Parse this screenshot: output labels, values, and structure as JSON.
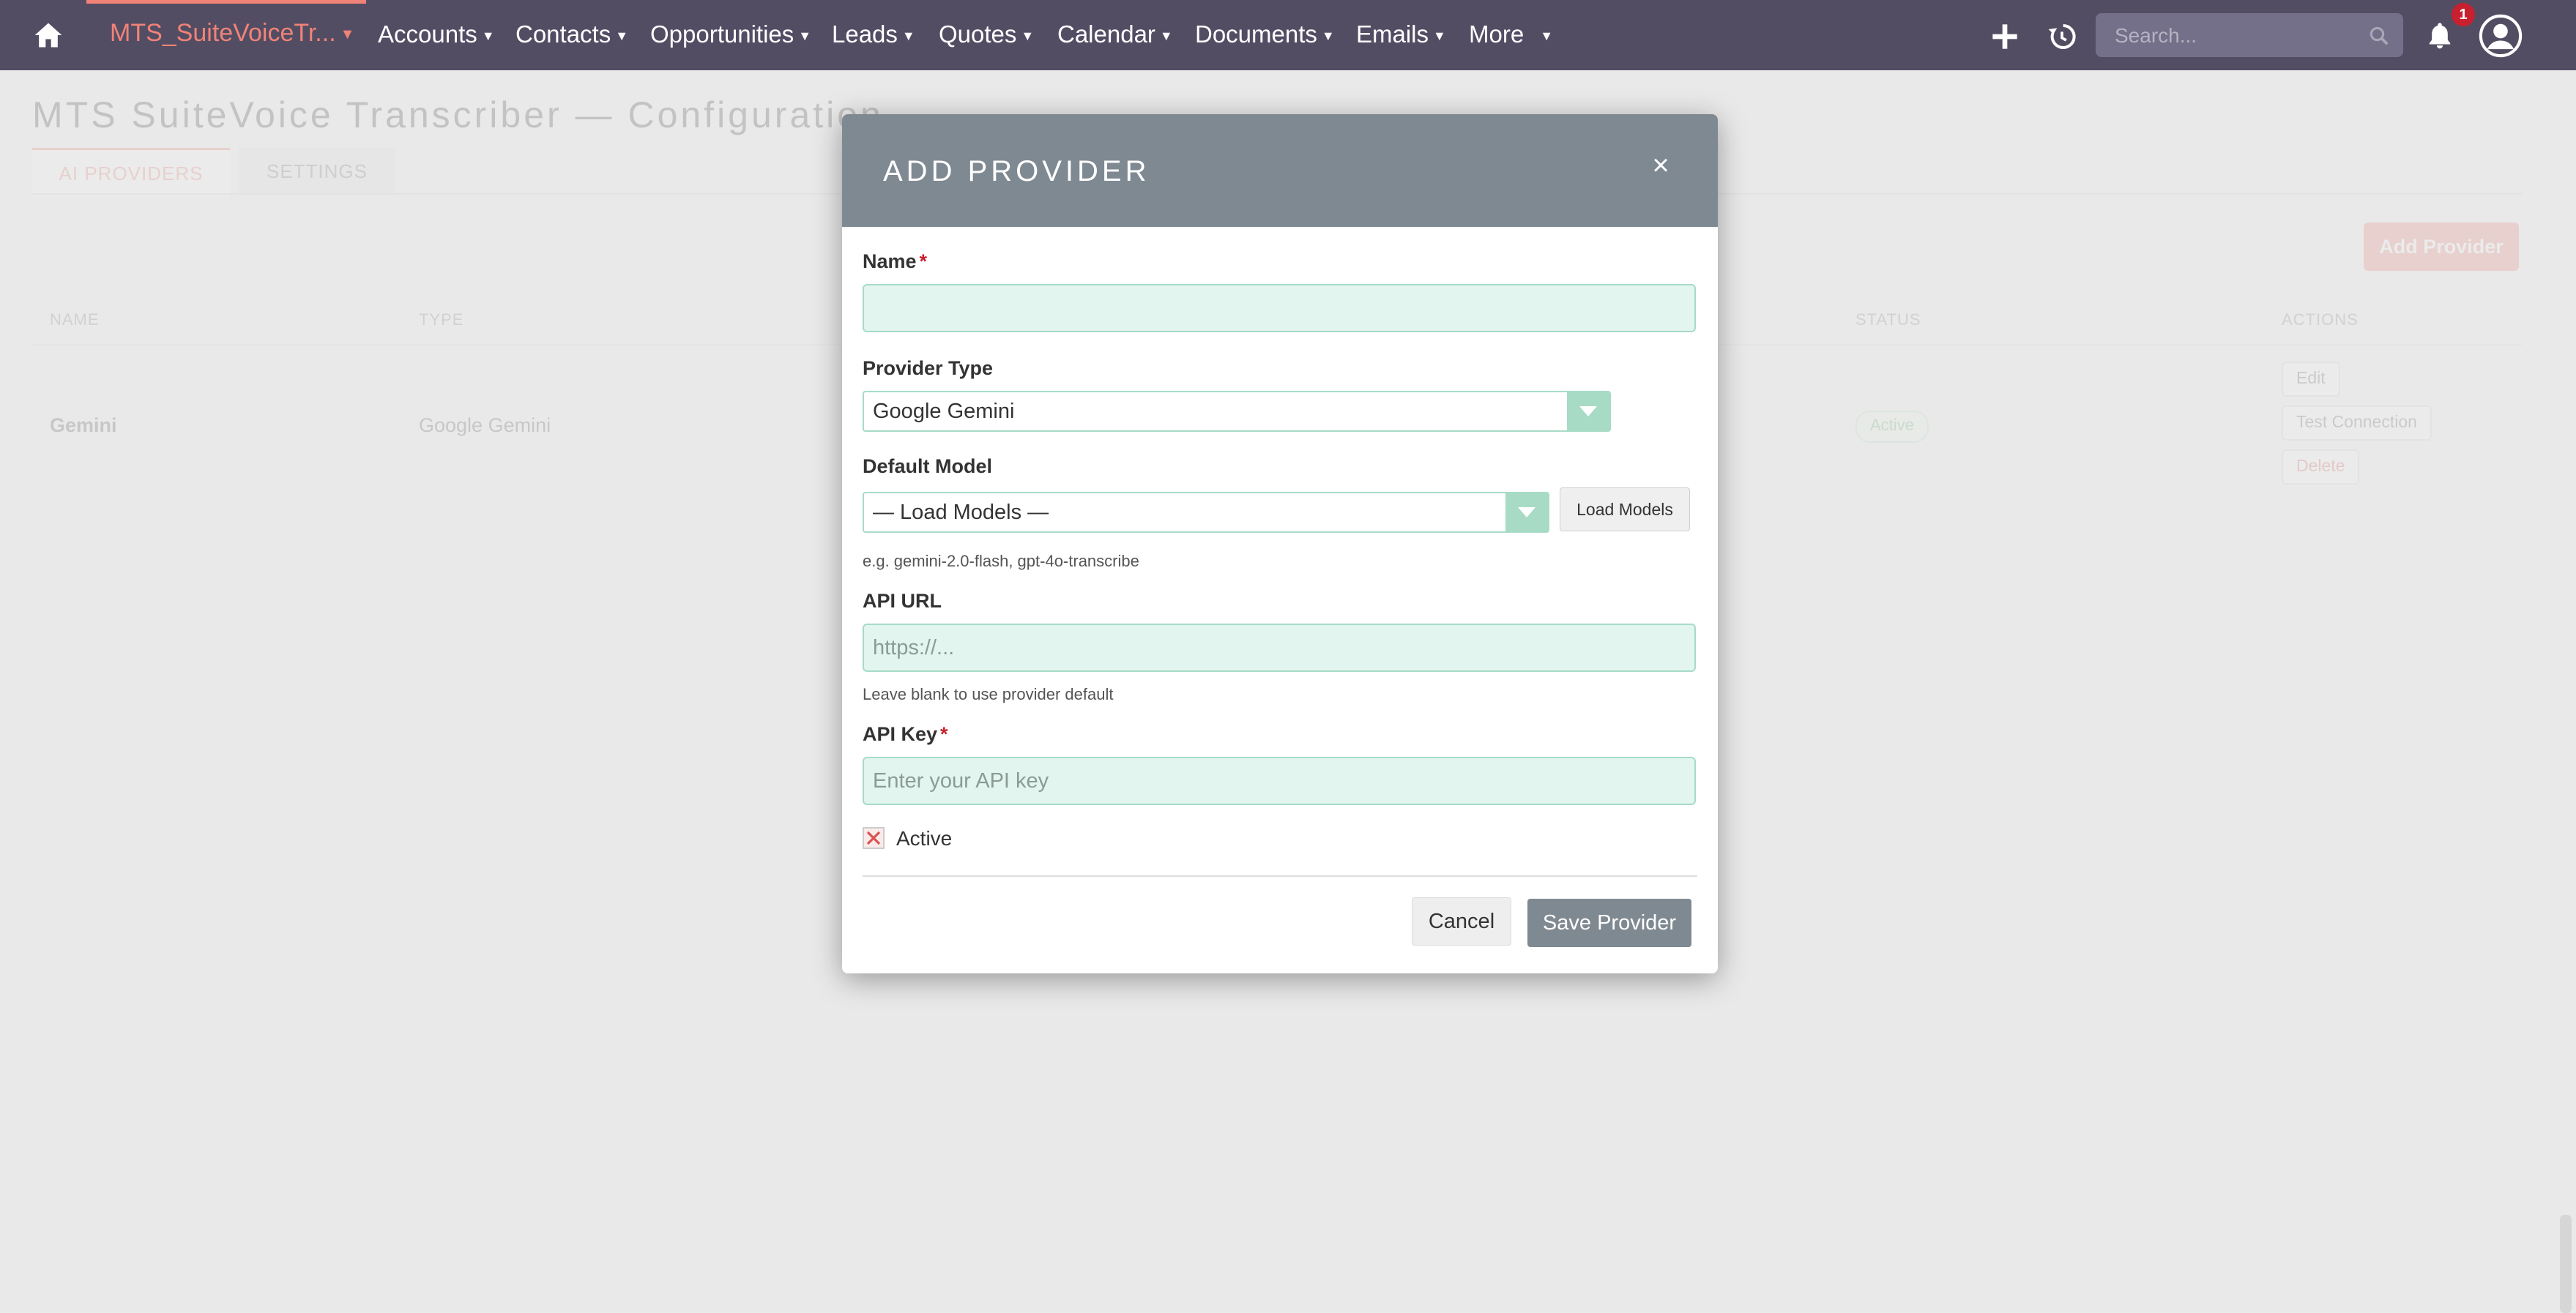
{
  "nav": {
    "current_module": "MTS_SuiteVoiceTr...",
    "items": [
      {
        "label": "Accounts"
      },
      {
        "label": "Contacts"
      },
      {
        "label": "Opportunities"
      },
      {
        "label": "Leads"
      },
      {
        "label": "Quotes"
      },
      {
        "label": "Calendar"
      },
      {
        "label": "Documents"
      },
      {
        "label": "Emails"
      },
      {
        "label": "More"
      }
    ],
    "search_placeholder": "Search...",
    "notification_count": "1",
    "icons": [
      "home-icon",
      "plus-icon",
      "history-icon",
      "search-icon",
      "bell-icon",
      "user-icon"
    ]
  },
  "page": {
    "title": "MTS SuiteVoice Transcriber — Configuration",
    "tabs": [
      {
        "label": "AI PROVIDERS",
        "active": true
      },
      {
        "label": "SETTINGS",
        "active": false
      }
    ],
    "add_provider_label": "Add Provider",
    "table": {
      "headers": {
        "name": "NAME",
        "type": "TYPE",
        "status": "STATUS",
        "actions": "ACTIONS"
      },
      "rows": [
        {
          "name": "Gemini",
          "type": "Google Gemini",
          "status": "Active",
          "actions": [
            "Edit",
            "Test Connection",
            "Delete"
          ]
        }
      ]
    }
  },
  "modal": {
    "title": "ADD PROVIDER",
    "close_symbol": "×",
    "name": {
      "label": "Name",
      "required_mark": "*",
      "value": "",
      "placeholder": ""
    },
    "provider_type": {
      "label": "Provider Type",
      "selected": "Google Gemini"
    },
    "default_model": {
      "label": "Default Model",
      "selected": "— Load Models —",
      "load_button": "Load Models",
      "help": "e.g. gemini-2.0-flash, gpt-4o-transcribe"
    },
    "api_url": {
      "label": "API URL",
      "value": "",
      "placeholder": "https://...",
      "help": "Leave blank to use provider default"
    },
    "api_key": {
      "label": "API Key",
      "required_mark": "*",
      "value": "",
      "placeholder": "Enter your API key"
    },
    "active": {
      "label": "Active",
      "checked": false
    },
    "cancel_label": "Cancel",
    "save_label": "Save Provider"
  },
  "colors": {
    "nav_bg": "#534d64",
    "accent": "#f08377",
    "modal_header": "#7f8992",
    "input_bg": "#e2f5ee",
    "input_border": "#a7dbc6",
    "required": "#c8202e"
  }
}
